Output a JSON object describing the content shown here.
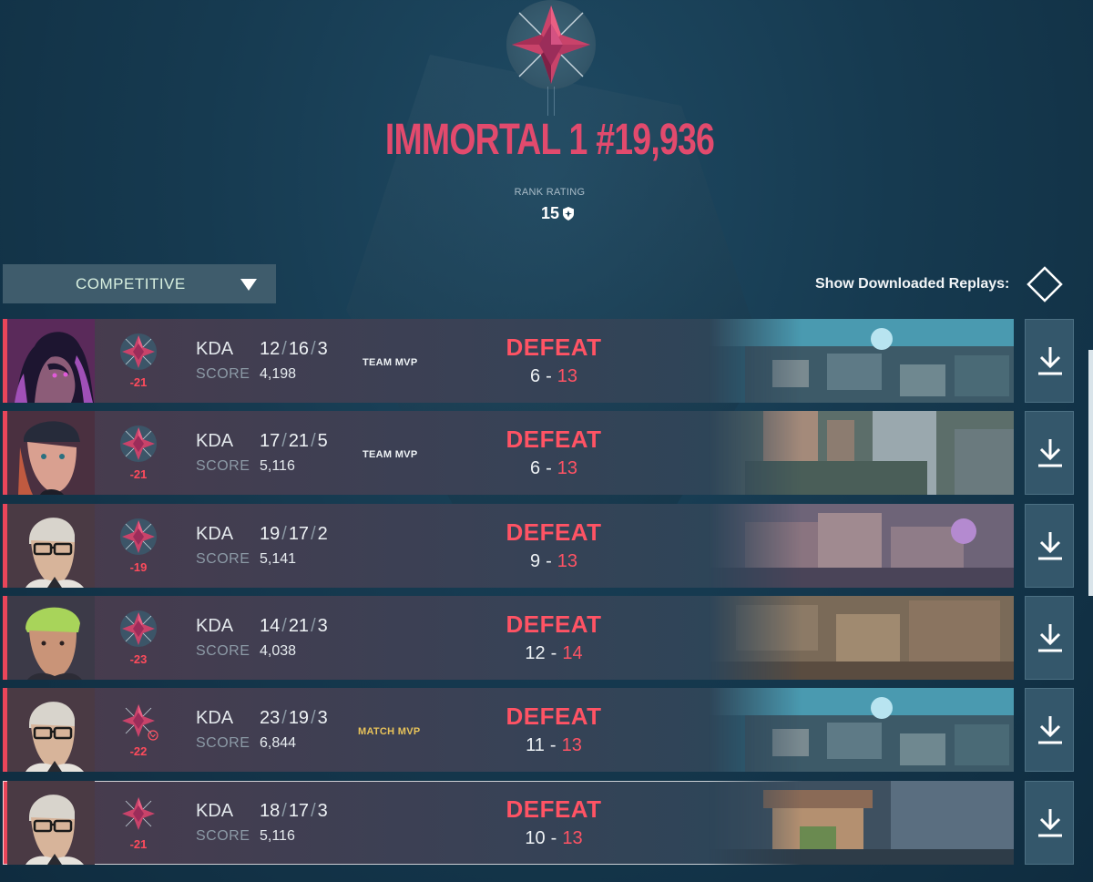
{
  "rank": {
    "title": "IMMORTAL 1 #19,936",
    "rr_label": "RANK RATING",
    "rr_value": "15"
  },
  "filter": {
    "mode": "COMPETITIVE",
    "replays_label": "Show Downloaded Replays:"
  },
  "colors": {
    "accent_red": "#ff5364",
    "mvp_gold": "#e8c35a",
    "rank_pink": "#e24a6d"
  },
  "kda_label": "KDA",
  "score_label": "SCORE",
  "matches": [
    {
      "agent": "agent-portrait-reyna",
      "rr_delta": "-21",
      "k": "12",
      "d": "16",
      "a": "3",
      "score": "4,198",
      "mvp": "TEAM MVP",
      "result": "DEFEAT",
      "ours": "6",
      "theirs": "13",
      "map": "map-thumbnail"
    },
    {
      "agent": "agent-portrait-reyna-alt",
      "rr_delta": "-21",
      "k": "17",
      "d": "21",
      "a": "5",
      "score": "5,116",
      "mvp": "TEAM MVP",
      "result": "DEFEAT",
      "ours": "6",
      "theirs": "13",
      "map": "map-thumbnail"
    },
    {
      "agent": "agent-portrait-chamber",
      "rr_delta": "-19",
      "k": "19",
      "d": "17",
      "a": "2",
      "score": "5,141",
      "mvp": "",
      "result": "DEFEAT",
      "ours": "9",
      "theirs": "13",
      "map": "map-thumbnail"
    },
    {
      "agent": "agent-portrait-neon-hair",
      "rr_delta": "-23",
      "k": "14",
      "d": "21",
      "a": "3",
      "score": "4,038",
      "mvp": "",
      "result": "DEFEAT",
      "ours": "12",
      "theirs": "14",
      "map": "map-thumbnail"
    },
    {
      "agent": "agent-portrait-chamber",
      "rr_delta": "-22",
      "k": "23",
      "d": "19",
      "a": "3",
      "score": "6,844",
      "mvp": "MATCH MVP",
      "result": "DEFEAT",
      "ours": "11",
      "theirs": "13",
      "map": "map-thumbnail"
    },
    {
      "agent": "agent-portrait-chamber",
      "rr_delta": "-21",
      "k": "18",
      "d": "17",
      "a": "3",
      "score": "5,116",
      "mvp": "",
      "result": "DEFEAT",
      "ours": "10",
      "theirs": "13",
      "map": "map-thumbnail"
    }
  ]
}
